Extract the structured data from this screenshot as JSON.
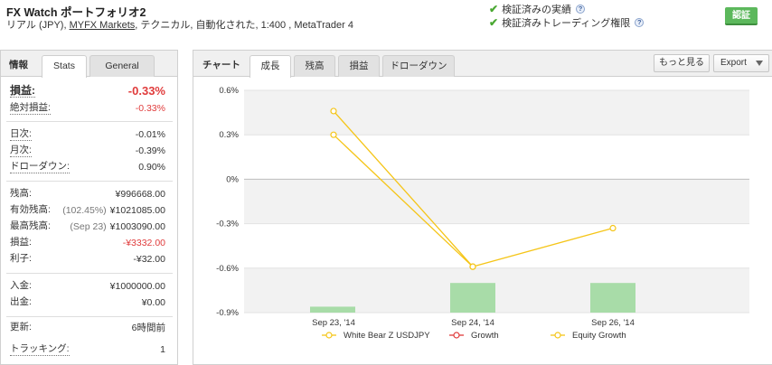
{
  "header": {
    "title": "FX Watch ポートフォリオ2",
    "subtitle_prefix": "リアル (JPY), ",
    "broker": "MYFX Markets",
    "subtitle_suffix": ", テクニカル, 自動化された, 1:400 , MetaTrader 4",
    "verify_track": "検証済みの実績",
    "verify_trading": "検証済みトレーディング権限",
    "follow_label": "認証"
  },
  "left": {
    "section_label": "情報",
    "tabs": [
      "Stats",
      "General"
    ],
    "stats": [
      {
        "key": "損益:",
        "value": "-0.33%"
      },
      {
        "key": "絶対損益:",
        "value": "-0.33%"
      },
      {
        "key": "日次:",
        "value": "-0.01%"
      },
      {
        "key": "月次:",
        "value": "-0.39%"
      },
      {
        "key": "ドローダウン:",
        "value": "0.90%"
      },
      {
        "key": "残高:",
        "value": "¥996668.00"
      },
      {
        "key": "有効残高:",
        "note": "(102.45%)",
        "value": "¥1021085.00"
      },
      {
        "key": "最高残高:",
        "note": "(Sep 23)",
        "value": "¥1003090.00"
      },
      {
        "key": "損益:",
        "value": "-¥3332.00"
      },
      {
        "key": "利子:",
        "value": "-¥32.00"
      },
      {
        "key": "入金:",
        "value": "¥1000000.00"
      },
      {
        "key": "出金:",
        "value": "¥0.00"
      },
      {
        "key": "更新:",
        "value": "6時間前"
      },
      {
        "key": "トラッキング:",
        "value": "1"
      }
    ]
  },
  "right": {
    "section_label": "チャート",
    "tabs": [
      "成長",
      "残高",
      "損益",
      "ドローダウン"
    ],
    "more_label": "もっと見る",
    "export_label": "Export"
  },
  "chart_data": {
    "type": "line",
    "categories": [
      "Sep 23, '14",
      "Sep 24, '14",
      "Sep 26, '14"
    ],
    "y_ticks": [
      "0.6%",
      "0.3%",
      "0%",
      "-0.3%",
      "-0.6%",
      "-0.9%"
    ],
    "ylim": [
      -0.9,
      0.6
    ],
    "series": [
      {
        "name": "White Bear Z USDJPY",
        "type": "bar",
        "color": "#a8dca8",
        "values": [
          -0.86,
          -0.7,
          -0.7
        ]
      },
      {
        "name": "Growth",
        "type": "line",
        "color": "#e03c3c",
        "values": [
          0.3,
          -0.59,
          null
        ]
      },
      {
        "name": "Equity Growth",
        "type": "line",
        "color": "#f5c518",
        "values": [
          0.46,
          -0.59,
          -0.33
        ]
      }
    ],
    "colors": {
      "growth_line": "#f5c518",
      "bars": "#a8dca8"
    }
  }
}
